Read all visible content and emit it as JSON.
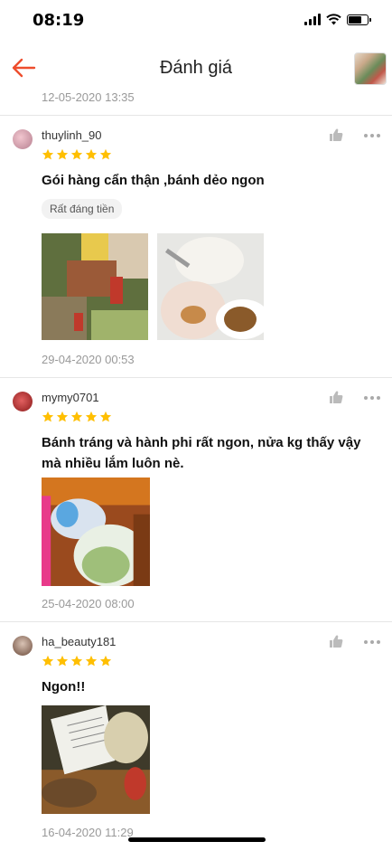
{
  "status": {
    "time": "08:19"
  },
  "header": {
    "title": "Đánh giá"
  },
  "previous_date": "12-05-2020 13:35",
  "reviews": [
    {
      "username": "thuylinh_90",
      "rating": 5,
      "text": "Gói hàng cẩn thận ,bánh dẻo ngon",
      "tag": "Rất đáng tiền",
      "photos": 2,
      "date": "29-04-2020 00:53"
    },
    {
      "username": "mymy0701",
      "rating": 5,
      "text": "Bánh tráng và hành phi rất ngon, nửa kg thấy vậy mà nhiều lắm luôn nè.",
      "photos": 1,
      "date": "25-04-2020 08:00"
    },
    {
      "username": "ha_beauty181",
      "rating": 5,
      "text": "Ngon!!",
      "photos": 1,
      "date": "16-04-2020 11:29"
    }
  ],
  "colors": {
    "accent": "#ee4d2d",
    "star": "#ffbf00"
  }
}
